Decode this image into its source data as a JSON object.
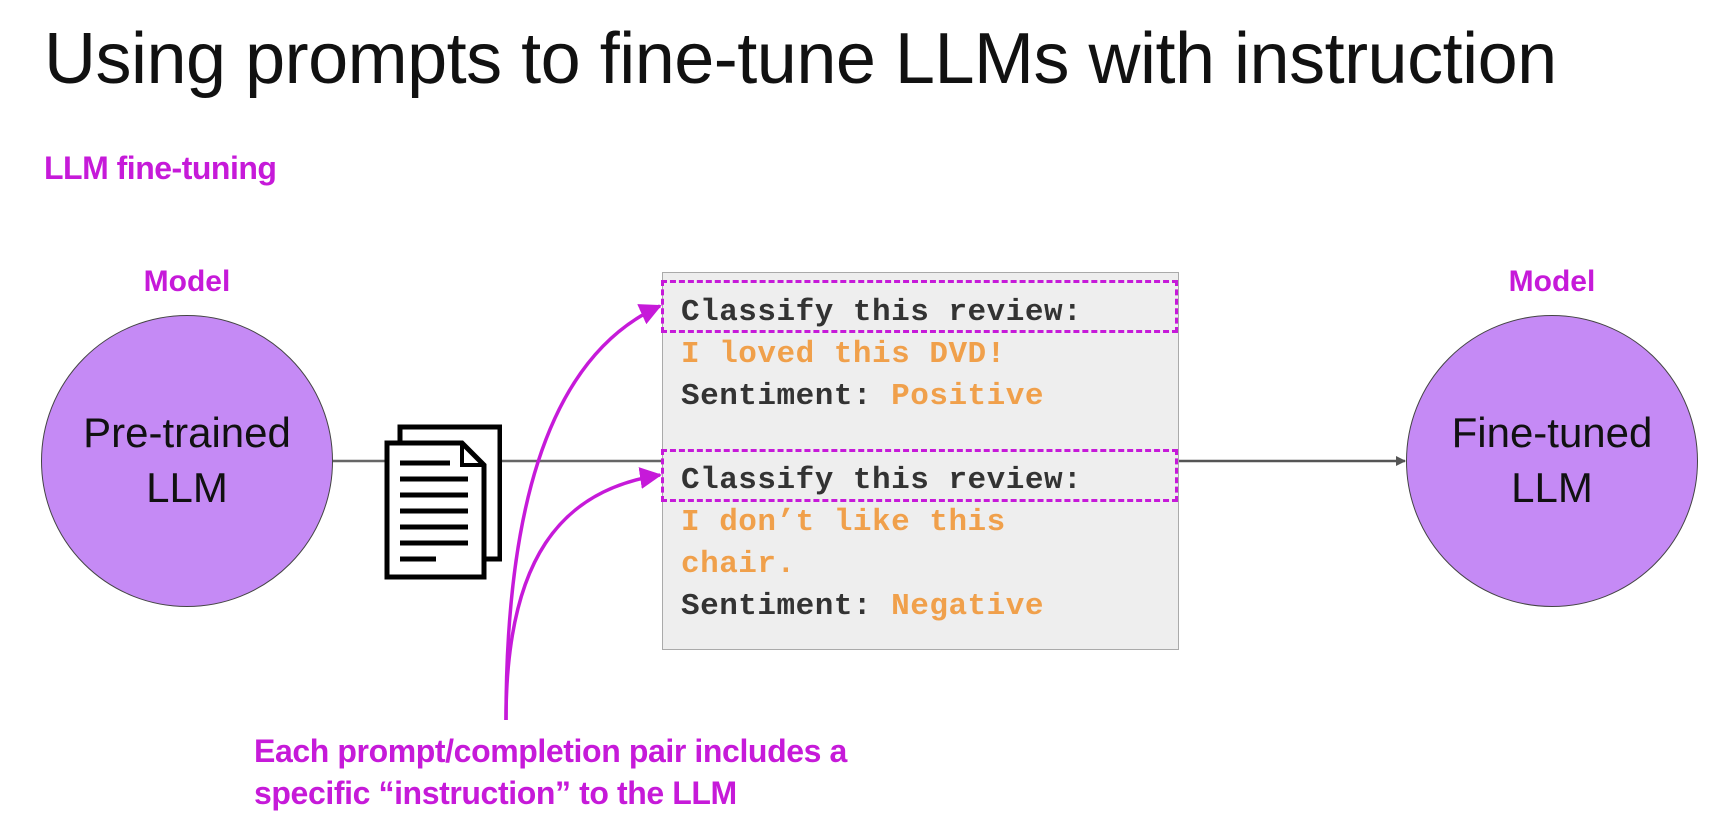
{
  "title": "Using prompts to fine-tune LLMs with instruction",
  "subtitle": "LLM fine-tuning",
  "colors": {
    "accent": "#c61ad9",
    "circle_fill": "#c58af5",
    "completion": "#f0a04b",
    "arrow": "#555555",
    "box_bg": "#eeeeee"
  },
  "left_model": {
    "label": "Model",
    "name": "Pre-trained LLM"
  },
  "right_model": {
    "label": "Model",
    "name": "Fine-tuned LLM"
  },
  "document_icon": "documents-icon",
  "examples": [
    {
      "instruction": "Classify this review:",
      "review": "I loved this DVD!",
      "sentiment_label": "Sentiment:",
      "sentiment_value": "Positive"
    },
    {
      "instruction": "Classify this review:",
      "review_line1": "I don’t like this",
      "review_line2": "chair.",
      "sentiment_label": "Sentiment:",
      "sentiment_value": "Negative"
    }
  ],
  "caption": {
    "line1": "Each prompt/completion pair includes a",
    "line2": "specific “instruction” to the LLM"
  }
}
